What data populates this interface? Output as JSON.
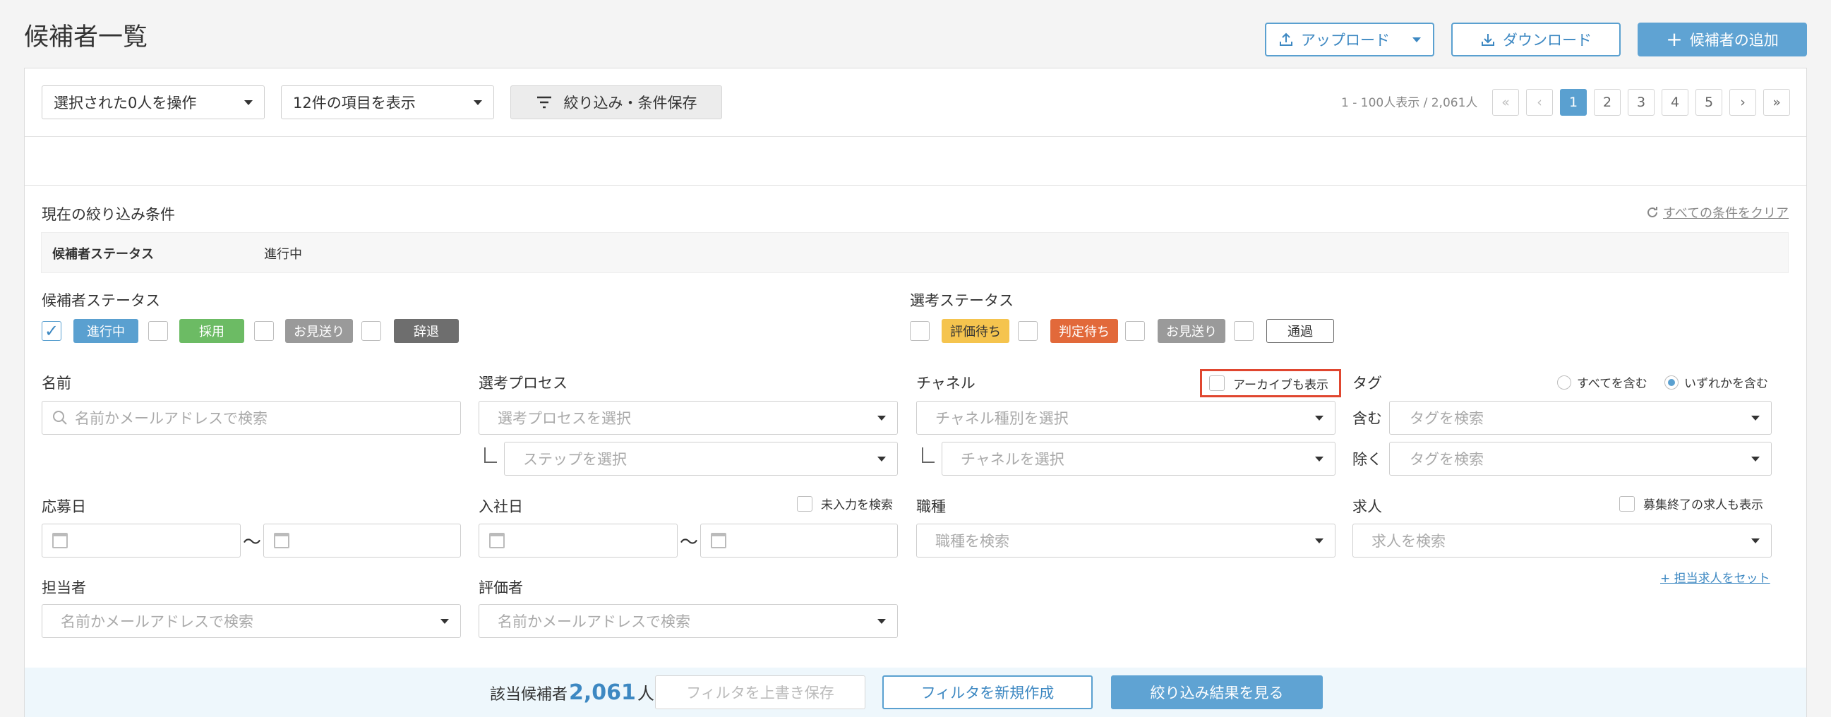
{
  "page": {
    "title": "候補者一覧"
  },
  "header": {
    "upload_label": "アップロード",
    "download_label": "ダウンロード",
    "add_label": "候補者の追加"
  },
  "toolbar": {
    "bulk_action": "選択された0人を操作",
    "display_count": "12件の項目を表示",
    "filter_save": "絞り込み・条件保存",
    "range_text": "1 - 100人表示 / 2,061人",
    "pages": [
      "1",
      "2",
      "3",
      "4",
      "5"
    ],
    "current_page": "1"
  },
  "conditions": {
    "title": "現在の絞り込み条件",
    "clear_all": "すべての条件をクリア",
    "row_key": "候補者ステータス",
    "row_value": "進行中"
  },
  "candidate_status": {
    "label": "候補者ステータス",
    "options": [
      {
        "label": "進行中",
        "checked": true,
        "color": "#5aa0d0"
      },
      {
        "label": "採用",
        "checked": false,
        "color": "#6cbb64"
      },
      {
        "label": "お見送り",
        "checked": false,
        "color": "#9a9a9a"
      },
      {
        "label": "辞退",
        "checked": false,
        "color": "#6e6e6e"
      }
    ]
  },
  "selection_status": {
    "label": "選考ステータス",
    "options": [
      {
        "label": "評価待ち",
        "checked": false,
        "color": "#f5c44e"
      },
      {
        "label": "判定待ち",
        "checked": false,
        "color": "#e2693a"
      },
      {
        "label": "お見送り",
        "checked": false,
        "color": "#9a9a9a"
      },
      {
        "label": "通過",
        "checked": false,
        "color": "#ffffff"
      }
    ]
  },
  "fields": {
    "name": {
      "label": "名前",
      "placeholder": "名前かメールアドレスで検索"
    },
    "process": {
      "label": "選考プロセス",
      "placeholder": "選考プロセスを選択",
      "step_placeholder": "ステップを選択"
    },
    "channel": {
      "label": "チャネル",
      "archive_label": "アーカイブも表示",
      "type_placeholder": "チャネル種別を選択",
      "channel_placeholder": "チャネルを選択"
    },
    "tag": {
      "label": "タグ",
      "radio_all": "すべてを含む",
      "radio_any": "いずれかを含む",
      "include_label": "含む",
      "exclude_label": "除く",
      "include_placeholder": "タグを検索",
      "exclude_placeholder": "タグを検索"
    },
    "applied_date": {
      "label": "応募日",
      "separator": "〜"
    },
    "join_date": {
      "label": "入社日",
      "unfilled_label": "未入力を検索",
      "separator": "〜"
    },
    "job_type": {
      "label": "職種",
      "placeholder": "職種を検索"
    },
    "job": {
      "label": "求人",
      "closed_label": "募集終了の求人も表示",
      "placeholder": "求人を検索",
      "set_link": "+ 担当求人をセット"
    },
    "owner": {
      "label": "担当者",
      "placeholder": "名前かメールアドレスで検索"
    },
    "evaluator": {
      "label": "評価者",
      "placeholder": "名前かメールアドレスで検索"
    }
  },
  "footer": {
    "result_label": "該当候補者",
    "result_count": "2,061",
    "result_unit": "人",
    "overwrite_label": "フィルタを上書き保存",
    "new_label": "フィルタを新規作成",
    "view_label": "絞り込み結果を見る"
  }
}
